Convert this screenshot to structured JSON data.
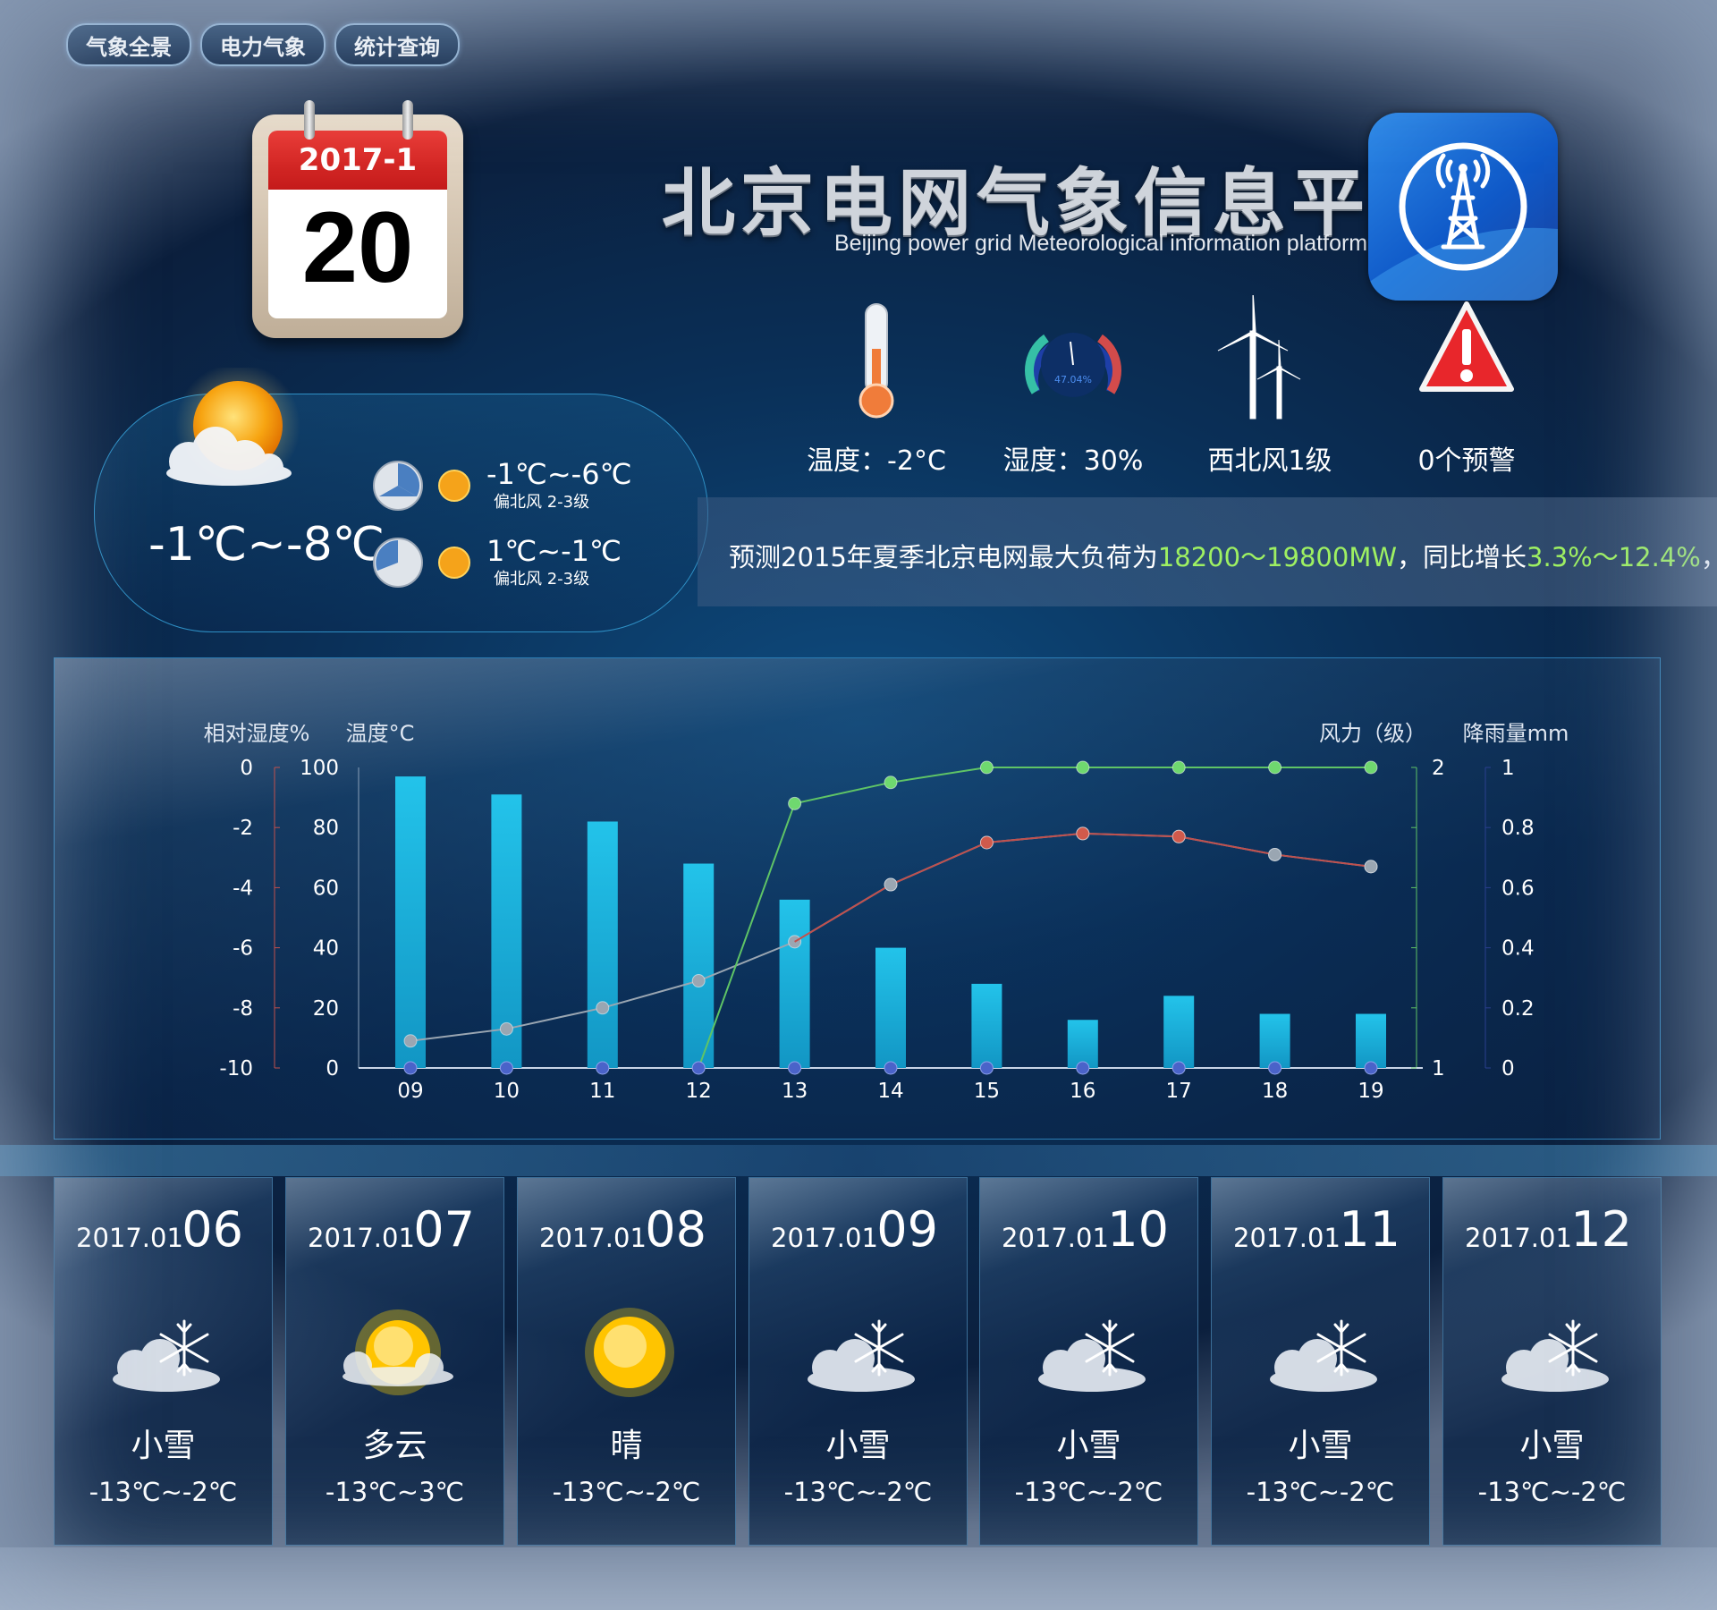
{
  "nav": [
    {
      "label": "气象全景"
    },
    {
      "label": "电力气象"
    },
    {
      "label": "统计查询"
    }
  ],
  "calendar": {
    "year_month": "2017-1",
    "day": "20"
  },
  "today": {
    "temp_range": "-1℃~-8℃",
    "periods": [
      {
        "temp": "-1℃~-6℃",
        "wind": "偏北风 2-3级"
      },
      {
        "temp": "1℃~-1℃",
        "wind": "偏北风 2-3级"
      }
    ]
  },
  "header": {
    "title": "北京电网气象信息平台",
    "subtitle": "Beijing power grid Meteorological information platform"
  },
  "stats": {
    "temperature": "温度：-2°C",
    "humidity": "湿度：30%",
    "humidity_gauge": "47.04%",
    "wind": "西北风1级",
    "alerts": "0个预警"
  },
  "marquee": {
    "prefix": "预测2015年夏季北京电网最大负荷为",
    "load": "18200～19800MW",
    "mid": "，同比增长",
    "growth": "3.3%～12.4%",
    "suffix": "，"
  },
  "chart_data": {
    "type": "bar",
    "labels": {
      "humidity_axis": "相对湿度%",
      "temp_axis": "温度°C",
      "wind_axis": "风力（级）",
      "rain_axis": "降雨量mm"
    },
    "categories": [
      "09",
      "10",
      "11",
      "12",
      "13",
      "14",
      "15",
      "16",
      "17",
      "18",
      "19"
    ],
    "axes": {
      "humidity": {
        "range": [
          -10,
          0
        ],
        "ticks": [
          "0",
          "-2",
          "-4",
          "-6",
          "-8",
          "-10"
        ]
      },
      "temperature": {
        "range": [
          0,
          100
        ],
        "ticks": [
          "100",
          "80",
          "60",
          "40",
          "20",
          "0"
        ]
      },
      "wind": {
        "range": [
          1,
          2
        ],
        "ticks": [
          "2",
          "1"
        ]
      },
      "rain": {
        "range": [
          0,
          1
        ],
        "ticks": [
          "1",
          "0.8",
          "0.6",
          "0.4",
          "0.2",
          "0"
        ]
      }
    },
    "series": [
      {
        "values": [
          97,
          91,
          82,
          68,
          56,
          40,
          28,
          16,
          24,
          18,
          18
        ]
      },
      {
        "values": [
          9,
          13,
          20,
          29,
          42,
          61,
          75,
          78,
          77,
          71,
          67
        ]
      },
      {
        "values": [
          1,
          1,
          1,
          1,
          1.88,
          1.95,
          2.0,
          2.0,
          2.0,
          2.0,
          2.0
        ]
      },
      {
        "values": [
          0,
          0,
          0,
          0,
          0,
          0,
          0,
          0,
          0,
          0,
          0
        ]
      }
    ],
    "colors": {
      "bar": "#1fb8e2",
      "gray_line": "#9aa6b2",
      "red_line": "#c0504d",
      "green_line": "#5fc466",
      "blue_dots": "#4a63c9"
    }
  },
  "forecast": [
    {
      "ym": "2017.01",
      "day": "06",
      "icon": "snow-cloud-icon",
      "desc": "小雪",
      "range": "-13℃~-2℃"
    },
    {
      "ym": "2017.01",
      "day": "07",
      "icon": "sun-cloud-icon",
      "desc": "多云",
      "range": "-13℃~3℃"
    },
    {
      "ym": "2017.01",
      "day": "08",
      "icon": "sun-icon",
      "desc": "晴",
      "range": "-13℃~-2℃"
    },
    {
      "ym": "2017.01",
      "day": "09",
      "icon": "snow-cloud-icon",
      "desc": "小雪",
      "range": "-13℃~-2℃"
    },
    {
      "ym": "2017.01",
      "day": "10",
      "icon": "snow-cloud-icon",
      "desc": "小雪",
      "range": "-13℃~-2℃"
    },
    {
      "ym": "2017.01",
      "day": "11",
      "icon": "snow-cloud-icon",
      "desc": "小雪",
      "range": "-13℃~-2℃"
    },
    {
      "ym": "2017.01",
      "day": "12",
      "icon": "snow-cloud-icon",
      "desc": "小雪",
      "range": "-13℃~-2℃"
    }
  ]
}
